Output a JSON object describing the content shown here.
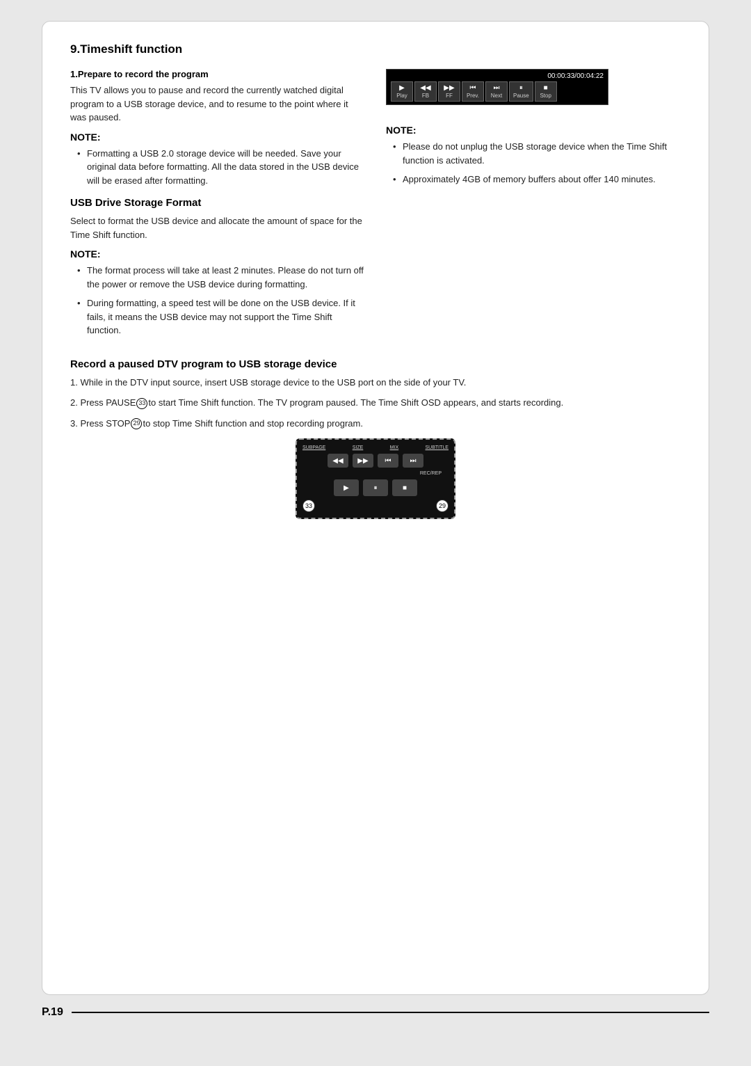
{
  "page": {
    "number": "P.19",
    "title": "9.Timeshift function"
  },
  "section1": {
    "subtitle": "1.Prepare to record the program",
    "body": "This TV allows you to pause and record the currently watched digital program  to a USB storage device, and to resume to the point where it was paused."
  },
  "osd": {
    "time": "00:00:33/00:04:22",
    "buttons": [
      {
        "icon": "▶",
        "label": "Play"
      },
      {
        "icon": "◀◀",
        "label": "FB"
      },
      {
        "icon": "▶▶",
        "label": "FF"
      },
      {
        "icon": "⏮",
        "label": "Prev."
      },
      {
        "icon": "⏭",
        "label": "Next"
      },
      {
        "icon": "⏸",
        "label": "Pause"
      },
      {
        "icon": "■",
        "label": "Stop"
      }
    ]
  },
  "note_left1": {
    "heading": "NOTE:",
    "items": [
      "Formatting a USB 2.0 storage device will be needed. Save your original data before formatting. All the data stored in the USB device will be erased after formatting."
    ]
  },
  "note_right1": {
    "heading": "NOTE:",
    "items": [
      "Please do not unplug the USB storage device when the Time Shift function is activated.",
      "Approximately 4GB of memory buffers about offer 140 minutes."
    ]
  },
  "usb_section": {
    "header": "USB Drive Storage Format",
    "body": "Select to format the USB device and allocate the amount of space for the Time Shift function."
  },
  "note_usb": {
    "heading": "NOTE:",
    "items": [
      "The format process will take at least 2 minutes. Please do not turn off the power or remove the USB device during formatting.",
      "During formatting, a speed test will be done on the USB device. If it fails, it means the USB device may not support the Time Shift function."
    ]
  },
  "record_section": {
    "header": "Record a paused DTV program to USB storage device",
    "step1": "1. While in the DTV input source, insert USB storage device to the USB port on the side of your TV.",
    "step2_pre": "2. Press PAUSE",
    "step2_num": "33",
    "step2_post": "to start Time Shift function. The TV program paused. The Time Shift OSD appears, and starts recording.",
    "step3_pre": "3. Press STOP",
    "step3_num": "29",
    "step3_post": "to stop Time Shift function and stop recording program."
  },
  "remote": {
    "top_labels": [
      "SUBPAGE",
      "SIZE",
      "MIX",
      "SUBTITLE"
    ],
    "row1": [
      "◀◀",
      "▶▶",
      "⏮",
      "⏭"
    ],
    "rec_label": "REC/REP",
    "row2": [
      "▶",
      "⏸",
      "■"
    ],
    "callout_left": "33",
    "callout_right": "29"
  }
}
